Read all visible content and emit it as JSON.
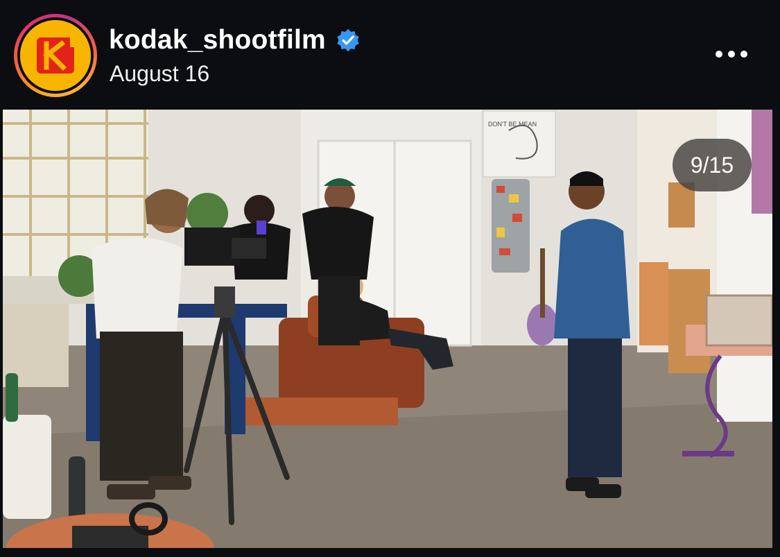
{
  "post": {
    "username": "kodak_shootfilm",
    "date": "August 16",
    "verified": true,
    "avatar_icon": "kodak-logo-icon",
    "more_icon": "more-options-icon"
  },
  "media": {
    "counter": "9/15",
    "sign_text": "DON'T BE MEAN",
    "description_icon": "photo"
  },
  "colors": {
    "background": "#0b0d10",
    "verified_blue": "#3897f0",
    "kodak_yellow": "#f7b500",
    "kodak_red": "#e2231a"
  }
}
